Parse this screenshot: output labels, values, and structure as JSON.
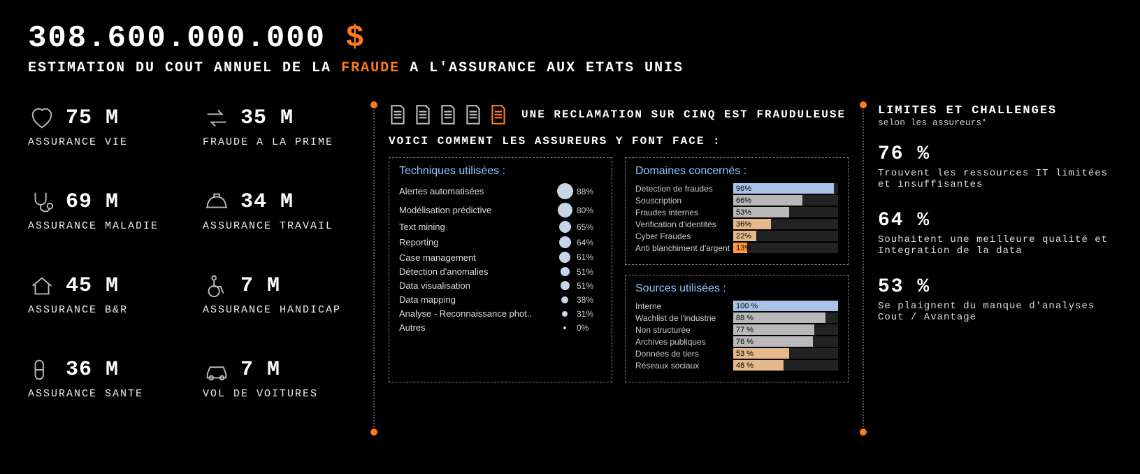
{
  "headline_number": "308.600.000.000",
  "headline_currency": "$",
  "subhead_pre": "ESTIMATION DU COUT ANNUEL DE LA ",
  "subhead_accent": "FRAUDE",
  "subhead_post": " A L'ASSURANCE AUX ETATS UNIS",
  "stats": [
    {
      "value": "75 M",
      "label": "ASSURANCE VIE",
      "icon": "heart"
    },
    {
      "value": "35 M",
      "label": "FRAUDE A LA PRIME",
      "icon": "arrows"
    },
    {
      "value": "69 M",
      "label": "ASSURANCE MALADIE",
      "icon": "steth"
    },
    {
      "value": "34 M",
      "label": "ASSURANCE TRAVAIL",
      "icon": "hardhat"
    },
    {
      "value": "45 M",
      "label": "ASSURANCE B&R",
      "icon": "house"
    },
    {
      "value": "7 M",
      "label": "ASSURANCE HANDICAP",
      "icon": "wheelchair"
    },
    {
      "value": "36 M",
      "label": "ASSURANCE SANTE",
      "icon": "pill"
    },
    {
      "value": "7 M",
      "label": "VOL DE VOITURES",
      "icon": "car"
    }
  ],
  "docs_line": "UNE RECLAMATION SUR CINQ EST FRAUDULEUSE",
  "center_sub": "VOICI COMMENT LES ASSUREURS Y FONT FACE :",
  "techniques_title": "Techniques utilisées :",
  "domaines_title": "Domaines concernés :",
  "sources_title": "Sources utilisées :",
  "right_title": "LIMITES ET CHALLENGES",
  "right_sub": "selon les assureurs*",
  "challenges": [
    {
      "pct": "76 %",
      "text": "Trouvent les ressources IT limitées et insuffisantes"
    },
    {
      "pct": "64 %",
      "text": "Souhaitent une meilleure qualité et Integration de la data"
    },
    {
      "pct": "53 %",
      "text": "Se plaignent du manque d'analyses Cout / Avantage"
    }
  ],
  "chart_data": {
    "techniques": {
      "type": "bubble",
      "title": "Techniques utilisées :",
      "items": [
        {
          "label": "Alertes automatisées",
          "value": 88
        },
        {
          "label": "Modélisation prédictive",
          "value": 80
        },
        {
          "label": "Text mining",
          "value": 65
        },
        {
          "label": "Reporting",
          "value": 64
        },
        {
          "label": "Case management",
          "value": 61
        },
        {
          "label": "Détection d'anomalies",
          "value": 51
        },
        {
          "label": "Data visualisation",
          "value": 51
        },
        {
          "label": "Data mapping",
          "value": 38
        },
        {
          "label": "Analyse - Reconnaissance phot..",
          "value": 31
        },
        {
          "label": "Autres",
          "value": 0
        }
      ]
    },
    "domaines": {
      "type": "bar",
      "title": "Domaines concernés :",
      "xlim": [
        0,
        100
      ],
      "items": [
        {
          "label": "Detection de fraudes",
          "value": 96,
          "color": "#a7c4e6"
        },
        {
          "label": "Souscription",
          "value": 66,
          "color": "#b9b9b9"
        },
        {
          "label": "Fraudes internes",
          "value": 53,
          "color": "#b9b9b9"
        },
        {
          "label": "Verification d'identités",
          "value": 36,
          "color": "#e6b98a"
        },
        {
          "label": "Cyber Fraudes",
          "value": 22,
          "color": "#e6b98a"
        },
        {
          "label": "Anti blanchiment d'argent",
          "value": 13,
          "color": "#ff9a3a"
        }
      ]
    },
    "sources": {
      "type": "bar",
      "title": "Sources utilisées :",
      "xlim": [
        0,
        100
      ],
      "items": [
        {
          "label": "Interne",
          "value": 100,
          "color": "#a7c4e6"
        },
        {
          "label": "Wachlist de l'industrie",
          "value": 88,
          "color": "#b9b9b9"
        },
        {
          "label": "Non structurée",
          "value": 77,
          "color": "#b9b9b9"
        },
        {
          "label": "Archives publiques",
          "value": 76,
          "color": "#b9b9b9"
        },
        {
          "label": "Données de tiers",
          "value": 53,
          "color": "#e6b98a"
        },
        {
          "label": "Réseaux sociaux",
          "value": 48,
          "color": "#e6b98a"
        }
      ]
    }
  }
}
